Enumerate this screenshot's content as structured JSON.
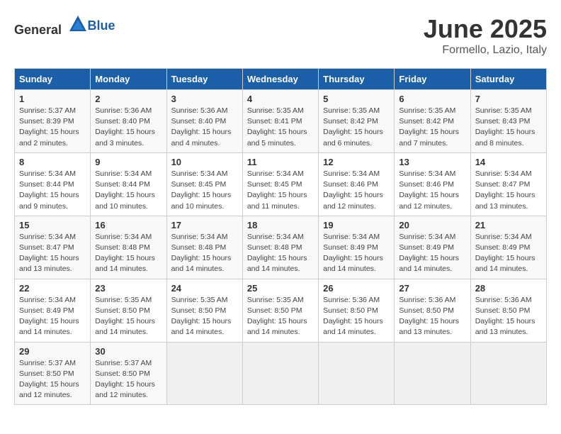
{
  "header": {
    "logo_general": "General",
    "logo_blue": "Blue",
    "month": "June 2025",
    "location": "Formello, Lazio, Italy"
  },
  "weekdays": [
    "Sunday",
    "Monday",
    "Tuesday",
    "Wednesday",
    "Thursday",
    "Friday",
    "Saturday"
  ],
  "weeks": [
    [
      {
        "day": "1",
        "info": "Sunrise: 5:37 AM\nSunset: 8:39 PM\nDaylight: 15 hours\nand 2 minutes."
      },
      {
        "day": "2",
        "info": "Sunrise: 5:36 AM\nSunset: 8:40 PM\nDaylight: 15 hours\nand 3 minutes."
      },
      {
        "day": "3",
        "info": "Sunrise: 5:36 AM\nSunset: 8:40 PM\nDaylight: 15 hours\nand 4 minutes."
      },
      {
        "day": "4",
        "info": "Sunrise: 5:35 AM\nSunset: 8:41 PM\nDaylight: 15 hours\nand 5 minutes."
      },
      {
        "day": "5",
        "info": "Sunrise: 5:35 AM\nSunset: 8:42 PM\nDaylight: 15 hours\nand 6 minutes."
      },
      {
        "day": "6",
        "info": "Sunrise: 5:35 AM\nSunset: 8:42 PM\nDaylight: 15 hours\nand 7 minutes."
      },
      {
        "day": "7",
        "info": "Sunrise: 5:35 AM\nSunset: 8:43 PM\nDaylight: 15 hours\nand 8 minutes."
      }
    ],
    [
      {
        "day": "8",
        "info": "Sunrise: 5:34 AM\nSunset: 8:44 PM\nDaylight: 15 hours\nand 9 minutes."
      },
      {
        "day": "9",
        "info": "Sunrise: 5:34 AM\nSunset: 8:44 PM\nDaylight: 15 hours\nand 10 minutes."
      },
      {
        "day": "10",
        "info": "Sunrise: 5:34 AM\nSunset: 8:45 PM\nDaylight: 15 hours\nand 10 minutes."
      },
      {
        "day": "11",
        "info": "Sunrise: 5:34 AM\nSunset: 8:45 PM\nDaylight: 15 hours\nand 11 minutes."
      },
      {
        "day": "12",
        "info": "Sunrise: 5:34 AM\nSunset: 8:46 PM\nDaylight: 15 hours\nand 12 minutes."
      },
      {
        "day": "13",
        "info": "Sunrise: 5:34 AM\nSunset: 8:46 PM\nDaylight: 15 hours\nand 12 minutes."
      },
      {
        "day": "14",
        "info": "Sunrise: 5:34 AM\nSunset: 8:47 PM\nDaylight: 15 hours\nand 13 minutes."
      }
    ],
    [
      {
        "day": "15",
        "info": "Sunrise: 5:34 AM\nSunset: 8:47 PM\nDaylight: 15 hours\nand 13 minutes."
      },
      {
        "day": "16",
        "info": "Sunrise: 5:34 AM\nSunset: 8:48 PM\nDaylight: 15 hours\nand 14 minutes."
      },
      {
        "day": "17",
        "info": "Sunrise: 5:34 AM\nSunset: 8:48 PM\nDaylight: 15 hours\nand 14 minutes."
      },
      {
        "day": "18",
        "info": "Sunrise: 5:34 AM\nSunset: 8:48 PM\nDaylight: 15 hours\nand 14 minutes."
      },
      {
        "day": "19",
        "info": "Sunrise: 5:34 AM\nSunset: 8:49 PM\nDaylight: 15 hours\nand 14 minutes."
      },
      {
        "day": "20",
        "info": "Sunrise: 5:34 AM\nSunset: 8:49 PM\nDaylight: 15 hours\nand 14 minutes."
      },
      {
        "day": "21",
        "info": "Sunrise: 5:34 AM\nSunset: 8:49 PM\nDaylight: 15 hours\nand 14 minutes."
      }
    ],
    [
      {
        "day": "22",
        "info": "Sunrise: 5:34 AM\nSunset: 8:49 PM\nDaylight: 15 hours\nand 14 minutes."
      },
      {
        "day": "23",
        "info": "Sunrise: 5:35 AM\nSunset: 8:50 PM\nDaylight: 15 hours\nand 14 minutes."
      },
      {
        "day": "24",
        "info": "Sunrise: 5:35 AM\nSunset: 8:50 PM\nDaylight: 15 hours\nand 14 minutes."
      },
      {
        "day": "25",
        "info": "Sunrise: 5:35 AM\nSunset: 8:50 PM\nDaylight: 15 hours\nand 14 minutes."
      },
      {
        "day": "26",
        "info": "Sunrise: 5:36 AM\nSunset: 8:50 PM\nDaylight: 15 hours\nand 14 minutes."
      },
      {
        "day": "27",
        "info": "Sunrise: 5:36 AM\nSunset: 8:50 PM\nDaylight: 15 hours\nand 13 minutes."
      },
      {
        "day": "28",
        "info": "Sunrise: 5:36 AM\nSunset: 8:50 PM\nDaylight: 15 hours\nand 13 minutes."
      }
    ],
    [
      {
        "day": "29",
        "info": "Sunrise: 5:37 AM\nSunset: 8:50 PM\nDaylight: 15 hours\nand 12 minutes."
      },
      {
        "day": "30",
        "info": "Sunrise: 5:37 AM\nSunset: 8:50 PM\nDaylight: 15 hours\nand 12 minutes."
      },
      {
        "day": "",
        "info": ""
      },
      {
        "day": "",
        "info": ""
      },
      {
        "day": "",
        "info": ""
      },
      {
        "day": "",
        "info": ""
      },
      {
        "day": "",
        "info": ""
      }
    ]
  ]
}
